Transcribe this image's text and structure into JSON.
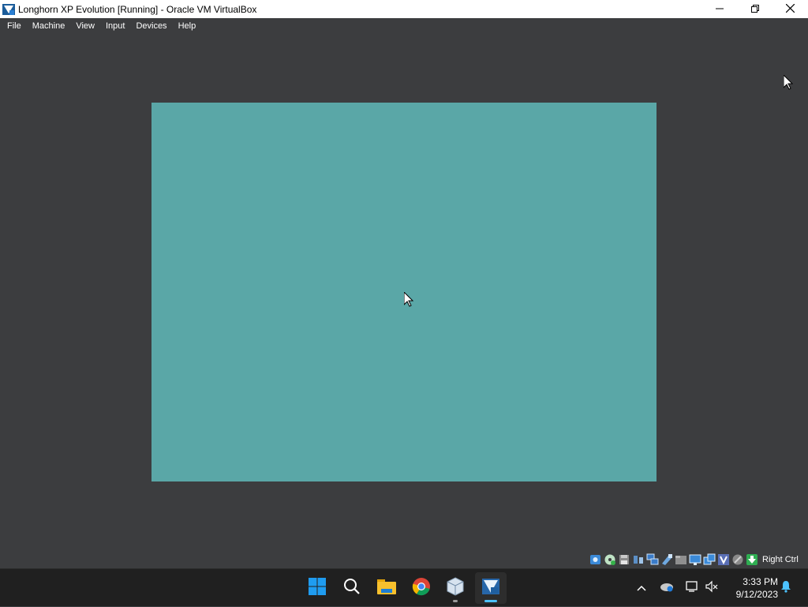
{
  "window": {
    "title": "Longhorn XP Evolution [Running] - Oracle VM VirtualBox",
    "icon": "virtualbox-vm-icon",
    "controls": [
      "minimize-icon",
      "restore-icon",
      "close-icon"
    ]
  },
  "menu": {
    "items": [
      {
        "label": "File"
      },
      {
        "label": "Machine"
      },
      {
        "label": "View"
      },
      {
        "label": "Input"
      },
      {
        "label": "Devices"
      },
      {
        "label": "Help"
      }
    ]
  },
  "vm": {
    "screen_color": "#5aa7a7",
    "background_color": "#3c3d3f"
  },
  "statusbar": {
    "icons": [
      "hard-disk-icon",
      "optical-drive-icon",
      "floppy-icon",
      "audio-icon",
      "network-icon",
      "usb-icon",
      "shared-folders-icon",
      "display-icon",
      "video-capture-icon",
      "virtualization-icon",
      "mouse-integration-icon",
      "keyboard-capture-icon"
    ],
    "host_key": "Right Ctrl"
  },
  "taskbar": {
    "apps": [
      "start-icon",
      "search-icon",
      "file-explorer-icon",
      "chrome-icon",
      "virtualbox-icon",
      "longhorn-xp-vm-icon"
    ],
    "tray_icons": [
      "chevron-up-icon",
      "onedrive-icon",
      "network-icon",
      "volume-muted-icon",
      "notification-bell-icon"
    ],
    "time": "3:33 PM",
    "date": "9/12/2023"
  }
}
